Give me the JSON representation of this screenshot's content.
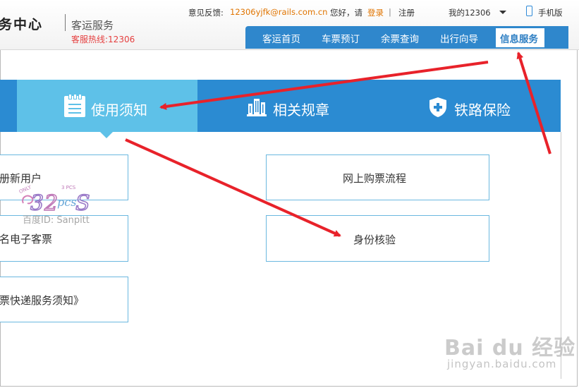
{
  "header": {
    "logo_text": "务中心",
    "logo_sub": "客运服务",
    "hotline": "客服热线:12306",
    "feedback_label": "意见反馈:",
    "feedback_email": "12306yjfk@rails.com.cn",
    "greeting": "您好，请",
    "login": "登录",
    "separator": "|",
    "register": "注册",
    "my_account": "我的12306",
    "mobile": "手机版"
  },
  "nav": {
    "items": [
      "客运首页",
      "车票预订",
      "余票查询",
      "出行向导"
    ],
    "active": "信息服务"
  },
  "tabs": {
    "items": [
      {
        "label": "使用须知",
        "icon": "document-icon"
      },
      {
        "label": "相关规章",
        "icon": "building-icon"
      },
      {
        "label": "铁路保险",
        "icon": "shield-plus-icon"
      }
    ]
  },
  "links": {
    "left": [
      "册新用户",
      "名电子客票",
      "票快递服务须知》"
    ],
    "right": [
      "网上购票流程",
      "身份核验"
    ]
  },
  "watermark": {
    "baidu": "Bai du 经验",
    "url": "jingyan.baidu.com",
    "author_id": "百度ID: Sanpitt",
    "author_small_1": "ONLY",
    "author_small_2": "3 PCS"
  },
  "colors": {
    "nav_blue": "#2f87cc",
    "tab_blue": "#2b8bd2",
    "tab_active": "#5ec1e8",
    "link_orange": "#e07400",
    "hotline_red": "#e53f3f",
    "arrow_red": "#e8222a",
    "box_border": "#6bb8e0"
  }
}
